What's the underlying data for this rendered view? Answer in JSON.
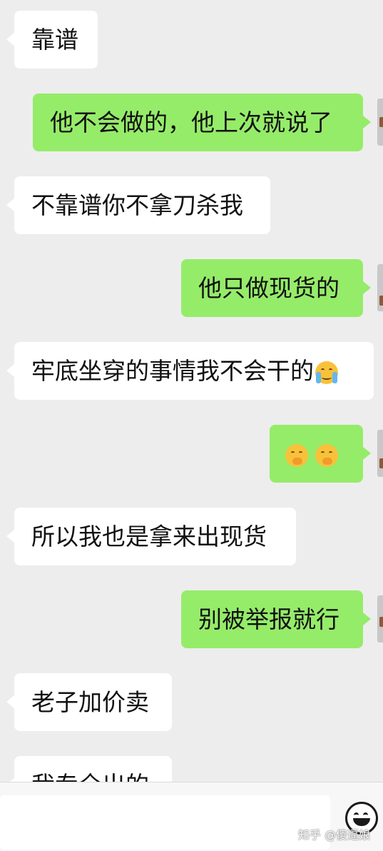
{
  "chat": {
    "messages": [
      {
        "side": "in",
        "text": "靠谱"
      },
      {
        "side": "out",
        "text": "他不会做的，他上次就说了"
      },
      {
        "side": "in",
        "text": "不靠谱你不拿刀杀我"
      },
      {
        "side": "out",
        "text": "他只做现货的"
      },
      {
        "side": "in",
        "text": "牢底坐穿的事情我不会干的",
        "emoji": "loudly-crying-face"
      },
      {
        "side": "out",
        "text": "",
        "emoji": "hand-over-mouth-face x2"
      },
      {
        "side": "in",
        "text": "所以我也是拿来出现货"
      },
      {
        "side": "out",
        "text": "别被举报就行"
      },
      {
        "side": "in",
        "text": "老子加价卖"
      },
      {
        "side": "in",
        "text": "我专全出的",
        "partial": true
      }
    ]
  },
  "input_bar": {
    "emoji_button_icon": "smiley-face-icon"
  },
  "watermark": "知乎 @傻逼娘",
  "colors": {
    "background": "#ededed",
    "incoming_bubble": "#ffffff",
    "outgoing_bubble": "#95ec69"
  }
}
